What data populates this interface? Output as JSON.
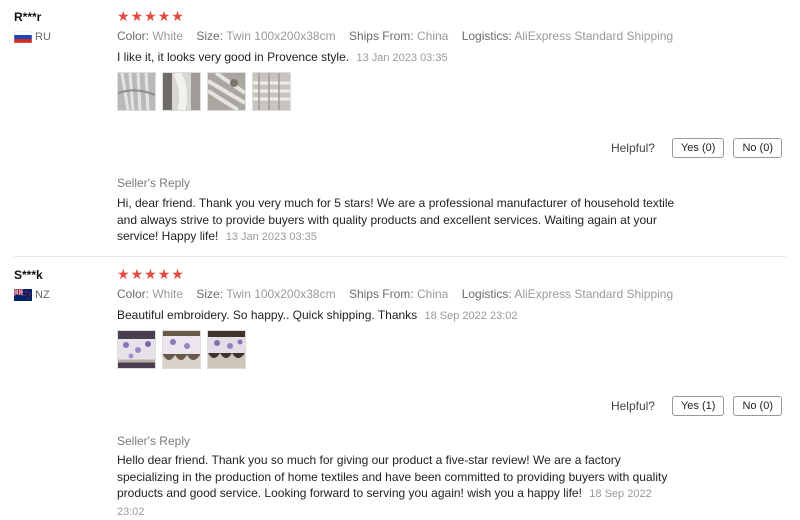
{
  "reviews": [
    {
      "user": "R***r",
      "country": "RU",
      "stars": 5,
      "color_label": "Color:",
      "color_value": "White",
      "size_label": "Size:",
      "size_value": "Twin 100x200x38cm",
      "ships_label": "Ships From:",
      "ships_value": "China",
      "logistics_label": "Logistics:",
      "logistics_value": "AliExpress Standard Shipping",
      "comment": "I like it, it looks very good in Provence style.",
      "date": "13 Jan 2023 03:35",
      "helpful_label": "Helpful?",
      "yes_label": "Yes (0)",
      "no_label": "No (0)",
      "reply_title": "Seller's Reply",
      "reply_text": "Hi, dear friend. Thank you very much for 5 stars! We are a professional manufacturer of household textile and always strive to provide buyers with quality products and excellent services. Waiting again at your service! Happy life!",
      "reply_date": "13 Jan 2023 03:35"
    },
    {
      "user": "S***k",
      "country": "NZ",
      "stars": 5,
      "color_label": "Color:",
      "color_value": "White",
      "size_label": "Size:",
      "size_value": "Twin 100x200x38cm",
      "ships_label": "Ships From:",
      "ships_value": "China",
      "logistics_label": "Logistics:",
      "logistics_value": "AliExpress Standard Shipping",
      "comment": "Beautiful embroidery. So happy.. Quick shipping. Thanks",
      "date": "18 Sep 2022 23:02",
      "helpful_label": "Helpful?",
      "yes_label": "Yes (1)",
      "no_label": "No (0)",
      "reply_title": "Seller's Reply",
      "reply_text": "Hello dear friend. Thank you so much for giving our product a five-star review! We are a factory specializing in the production of home textiles and have been committed to providing buyers with quality products and good service. Looking forward to serving you again! wish you a happy life!",
      "reply_date": "18 Sep 2022 23:02"
    }
  ],
  "colors": {
    "star": "#e7483f",
    "label": "#6b6b6b",
    "muted": "#9a9a9a",
    "divider": "#e8e8e8"
  },
  "icons": {
    "star": "star-icon",
    "flag_ru": "russia-flag-icon",
    "flag_nz": "new-zealand-flag-icon"
  }
}
